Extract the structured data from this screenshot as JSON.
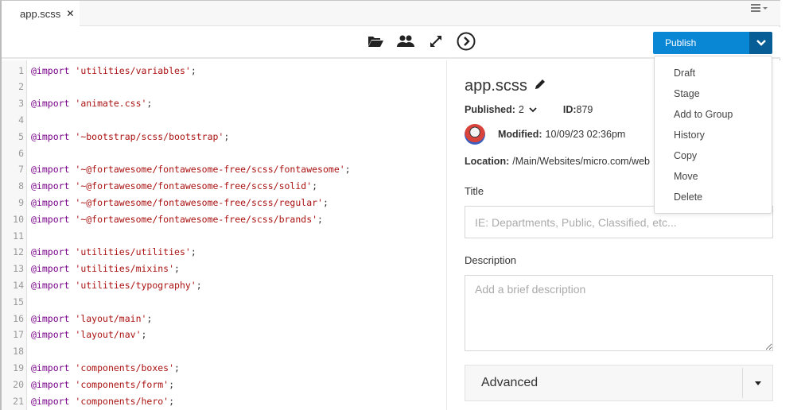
{
  "tabbar": {
    "tabs": [
      {
        "label": "app.scss",
        "close_icon": "close-icon",
        "active": true
      }
    ],
    "menu_icon": "hamburger-menu-icon"
  },
  "toolbar": {
    "icons": [
      {
        "name": "folder-open-icon",
        "title": "Open"
      },
      {
        "name": "users-icon",
        "title": "Users"
      },
      {
        "name": "expand-icon",
        "title": "Expand"
      },
      {
        "name": "circle-chevron-right-icon",
        "title": "Next"
      }
    ],
    "publish_label": "Publish",
    "publish_color": "#0a87d4",
    "publish_caret_color": "#075e96"
  },
  "publish_menu": {
    "items": [
      "Draft",
      "Stage",
      "Add to Group",
      "History",
      "Copy",
      "Move",
      "Delete"
    ]
  },
  "editor": {
    "lines": [
      {
        "n": "1",
        "kw": "@import",
        "str": "'utilities/variables'",
        "end": ";"
      },
      {
        "n": "2",
        "kw": "",
        "str": "",
        "end": ""
      },
      {
        "n": "3",
        "kw": "@import",
        "str": "'animate.css'",
        "end": ";"
      },
      {
        "n": "4",
        "kw": "",
        "str": "",
        "end": ""
      },
      {
        "n": "5",
        "kw": "@import",
        "str": "'~bootstrap/scss/bootstrap'",
        "end": ";"
      },
      {
        "n": "6",
        "kw": "",
        "str": "",
        "end": ""
      },
      {
        "n": "7",
        "kw": "@import",
        "str": "'~@fortawesome/fontawesome-free/scss/fontawesome'",
        "end": ";"
      },
      {
        "n": "8",
        "kw": "@import",
        "str": "'~@fortawesome/fontawesome-free/scss/solid'",
        "end": ";"
      },
      {
        "n": "9",
        "kw": "@import",
        "str": "'~@fortawesome/fontawesome-free/scss/regular'",
        "end": ";"
      },
      {
        "n": "10",
        "kw": "@import",
        "str": "'~@fortawesome/fontawesome-free/scss/brands'",
        "end": ";"
      },
      {
        "n": "11",
        "kw": "",
        "str": "",
        "end": ""
      },
      {
        "n": "12",
        "kw": "@import",
        "str": "'utilities/utilities'",
        "end": ";"
      },
      {
        "n": "13",
        "kw": "@import",
        "str": "'utilities/mixins'",
        "end": ";"
      },
      {
        "n": "14",
        "kw": "@import",
        "str": "'utilities/typography'",
        "end": ";"
      },
      {
        "n": "15",
        "kw": "",
        "str": "",
        "end": ""
      },
      {
        "n": "16",
        "kw": "@import",
        "str": "'layout/main'",
        "end": ";"
      },
      {
        "n": "17",
        "kw": "@import",
        "str": "'layout/nav'",
        "end": ";"
      },
      {
        "n": "18",
        "kw": "",
        "str": "",
        "end": ""
      },
      {
        "n": "19",
        "kw": "@import",
        "str": "'components/boxes'",
        "end": ";"
      },
      {
        "n": "20",
        "kw": "@import",
        "str": "'components/form'",
        "end": ";"
      },
      {
        "n": "21",
        "kw": "@import",
        "str": "'components/hero'",
        "end": ";"
      }
    ]
  },
  "panel": {
    "file_title": "app.scss",
    "edit_icon": "pencil-icon",
    "published_label": "Published:",
    "published_value": "2",
    "id_label": "ID:",
    "id_value": "879",
    "modified_label": "Modified:",
    "modified_value": "10/09/23 02:36pm",
    "location_label": "Location:",
    "location_value": "/Main/Websites/micro.com/web",
    "title_label": "Title",
    "title_value": "",
    "title_placeholder": "IE: Departments, Public, Classified, etc...",
    "description_label": "Description",
    "description_value": "",
    "description_placeholder": "Add a brief description",
    "advanced_label": "Advanced"
  }
}
